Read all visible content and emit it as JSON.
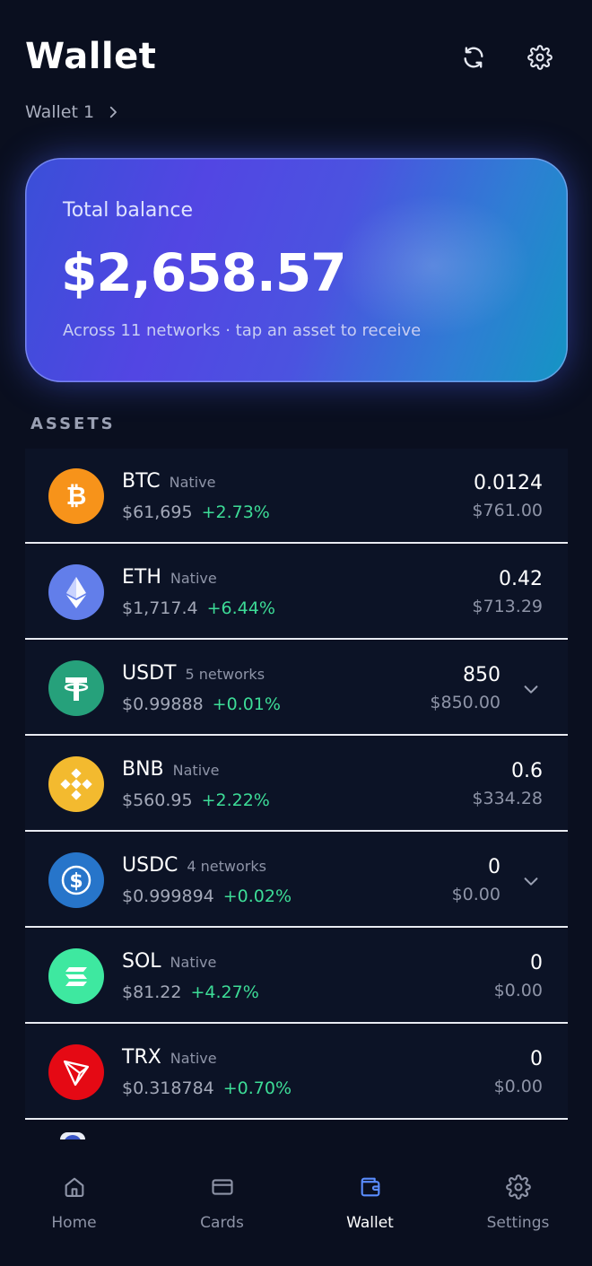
{
  "header": {
    "title": "Wallet",
    "refresh_icon": "refresh-icon",
    "settings_icon": "gear-icon"
  },
  "wallet_selector": {
    "label": "Wallet 1",
    "icon": "chevron-right-icon"
  },
  "balance": {
    "label": "Total balance",
    "amount": "$2,658.57",
    "subtitle": "Across 11 networks · tap an asset to receive"
  },
  "assets_label": "ASSETS",
  "assets": [
    {
      "symbol": "BTC",
      "tag": "Native",
      "price": "$61,695",
      "change": "+2.73%",
      "amount": "0.0124",
      "value": "$761.00",
      "icon": "bitcoin-icon",
      "color": "#f7931a"
    },
    {
      "symbol": "ETH",
      "tag": "Native",
      "price": "$1,717.4",
      "change": "+6.44%",
      "amount": "0.42",
      "value": "$713.29",
      "icon": "ethereum-icon",
      "color": "#627eea"
    },
    {
      "symbol": "USDT",
      "tag": "5 networks",
      "price": "$0.99888",
      "change": "+0.01%",
      "amount": "850",
      "value": "$850.00",
      "icon": "tether-icon",
      "color": "#26a17b",
      "expandable": true
    },
    {
      "symbol": "BNB",
      "tag": "Native",
      "price": "$560.95",
      "change": "+2.22%",
      "amount": "0.6",
      "value": "$334.28",
      "icon": "bnb-icon",
      "color": "#f3ba2f"
    },
    {
      "symbol": "USDC",
      "tag": "4 networks",
      "price": "$0.999894",
      "change": "+0.02%",
      "amount": "0",
      "value": "$0.00",
      "icon": "usdc-icon",
      "color": "#2775ca",
      "expandable": true
    },
    {
      "symbol": "SOL",
      "tag": "Native",
      "price": "$81.22",
      "change": "+4.27%",
      "amount": "0",
      "value": "$0.00",
      "icon": "solana-icon",
      "color": "#3ee8a0"
    },
    {
      "symbol": "TRX",
      "tag": "Native",
      "price": "$0.318784",
      "change": "+0.70%",
      "amount": "0",
      "value": "$0.00",
      "icon": "tron-icon",
      "color": "#e50914"
    }
  ],
  "nav": [
    {
      "label": "Home",
      "icon": "home-icon",
      "active": false
    },
    {
      "label": "Cards",
      "icon": "card-icon",
      "active": false
    },
    {
      "label": "Wallet",
      "icon": "wallet-icon",
      "active": true
    },
    {
      "label": "Settings",
      "icon": "gear-icon",
      "active": false
    }
  ],
  "colors": {
    "background": "#0a0f1f",
    "positive": "#3ddc97",
    "accent": "#5b8dff"
  }
}
